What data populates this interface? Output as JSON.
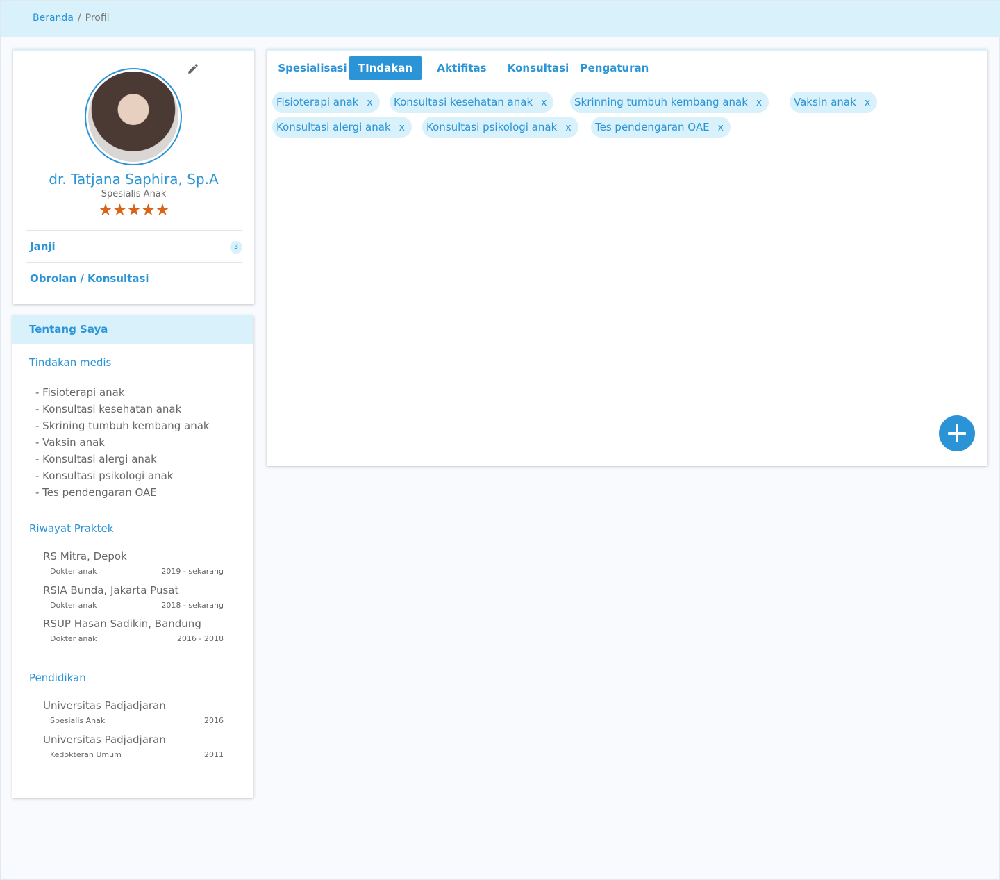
{
  "breadcrumb": {
    "home": "Beranda",
    "separator": "/",
    "current": "Profil"
  },
  "profile": {
    "name": "dr. Tatjana Saphira, Sp.A",
    "specialty": "Spesialis Anak",
    "rating": 5,
    "stars": "★★★★★",
    "menu": [
      {
        "label": "Janji",
        "badge": "3"
      },
      {
        "label": "Obrolan / Konsultasi"
      }
    ]
  },
  "about": {
    "title": "Tentang Saya",
    "tindakan_title": "Tindakan medis",
    "tindakan": [
      "- Fisioterapi anak",
      "- Konsultasi kesehatan anak",
      "- Skrining tumbuh kembang anak",
      "- Vaksin anak",
      "- Konsultasi alergi anak",
      "- Konsultasi psikologi anak",
      "- Tes pendengaran OAE"
    ],
    "riwayat_title": "Riwayat Praktek",
    "riwayat": [
      {
        "place": "RS Mitra, Depok",
        "role": "Dokter anak",
        "years": "2019 - sekarang"
      },
      {
        "place": "RSIA Bunda, Jakarta Pusat",
        "role": "Dokter anak",
        "years": "2018 - sekarang"
      },
      {
        "place": "RSUP Hasan Sadikin, Bandung",
        "role": "Dokter anak",
        "years": "2016 - 2018"
      }
    ],
    "pendidikan_title": "Pendidikan",
    "pendidikan": [
      {
        "place": "Universitas Padjadjaran",
        "role": "Spesialis Anak",
        "years": "2016"
      },
      {
        "place": "Universitas Padjadjaran",
        "role": "Kedokteran Umum",
        "years": "2011"
      }
    ]
  },
  "tabs": [
    "Spesialisasi",
    "TIndakan",
    "Aktifitas",
    "Konsultasi",
    "Pengaturan"
  ],
  "active_tab": "TIndakan",
  "chips": [
    "Fisioterapi anak",
    "Konsultasi kesehatan anak",
    "Skrinning tumbuh kembang anak",
    "Vaksin anak",
    "Konsultasi alergi anak",
    "Konsultasi psikologi anak",
    "Tes pendengaran OAE"
  ],
  "chip_remove": "x",
  "icons": {
    "edit": "pencil-icon",
    "add": "plus-icon"
  },
  "colors": {
    "accent": "#2a94d6",
    "header_bg": "#d8f1fa",
    "star": "#d8651a"
  }
}
